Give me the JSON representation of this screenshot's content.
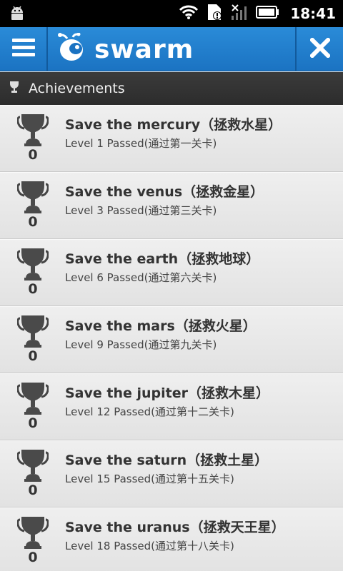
{
  "status_bar": {
    "time": "18:41"
  },
  "app_bar": {
    "logo_text": "swarm",
    "brand_color": "#1f7fcf"
  },
  "section": {
    "title": "Achievements"
  },
  "achievements": [
    {
      "name": "Save the mercury（拯救水星）",
      "desc": "Level 1 Passed(通过第一关卡)",
      "count": "0"
    },
    {
      "name": "Save the venus（拯救金星）",
      "desc": "Level 3 Passed(通过第三关卡)",
      "count": "0"
    },
    {
      "name": "Save the earth（拯救地球）",
      "desc": "Level 6 Passed(通过第六关卡)",
      "count": "0"
    },
    {
      "name": "Save the mars（拯救火星）",
      "desc": "Level 9 Passed(通过第九关卡)",
      "count": "0"
    },
    {
      "name": "Save the jupiter（拯救木星）",
      "desc": "Level 12 Passed(通过第十二关卡)",
      "count": "0"
    },
    {
      "name": "Save the saturn（拯救土星）",
      "desc": "Level 15 Passed(通过第十五关卡)",
      "count": "0"
    },
    {
      "name": "Save the uranus（拯救天王星）",
      "desc": "Level 18 Passed(通过第十八关卡)",
      "count": "0"
    }
  ]
}
